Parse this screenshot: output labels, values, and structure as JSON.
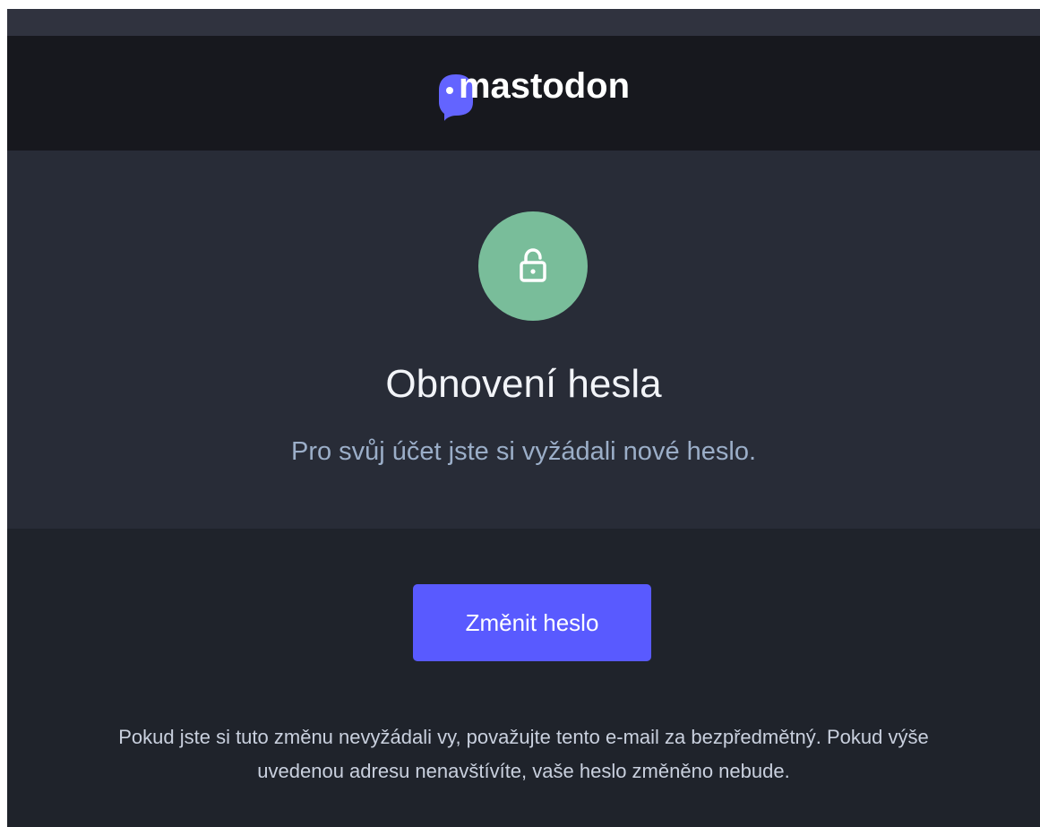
{
  "header": {
    "logo_icon": "mastodon-logo-icon",
    "brand_name": "mastodon"
  },
  "hero": {
    "icon": "unlock-icon",
    "title": "Obnovení hesla",
    "subtitle": "Pro svůj účet jste si vyžádali nové heslo."
  },
  "action": {
    "button_label": "Změnit heslo"
  },
  "notice": {
    "line1": "Pokud jste si tuto změnu nevyžádali vy, považujte tento e-mail za bezpředmětný. Pokud výše",
    "line2": "uvedenou adresu nenavštívíte, vaše heslo změněno nebude."
  },
  "colors": {
    "brand_bar": "#17181e",
    "hero_background": "#282c37",
    "page_background": "#1f232b",
    "icon_circle": "#79bd9a",
    "button": "#595aff",
    "subtitle": "#9baec8"
  }
}
